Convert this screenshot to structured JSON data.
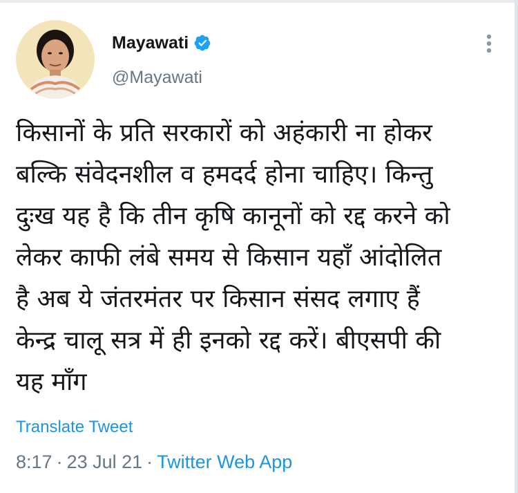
{
  "user": {
    "display_name": "Mayawati",
    "handle": "@Mayawati",
    "verified_icon": "verified-badge-icon"
  },
  "tweet": {
    "text": "किसानों के प्रति सरकारों को अहंकारी ना होकर\nबल्कि संवेदनशील व हमदर्द होना चाहिए। किन्तु\nदुःख यह है कि तीन कृषि कानूनों को रद्द करने को\nलेकर काफी लंबे समय से किसान यहाँ आंदोलित\nहै अब ये जंतरमंतर पर किसान संसद लगाए हैं\nकेन्द्र चालू सत्र में ही इनको रद्द करें। बीएसपी की\nयह माँग"
  },
  "translate_label": "Translate Tweet",
  "meta": {
    "time": "8:17",
    "separator": "·",
    "date": "23 Jul 21",
    "source": "Twitter Web App"
  },
  "icons": {
    "more": "more-options-icon"
  },
  "colors": {
    "link": "#1b95e0",
    "secondary_text": "#657786",
    "primary_text": "#14171a"
  }
}
